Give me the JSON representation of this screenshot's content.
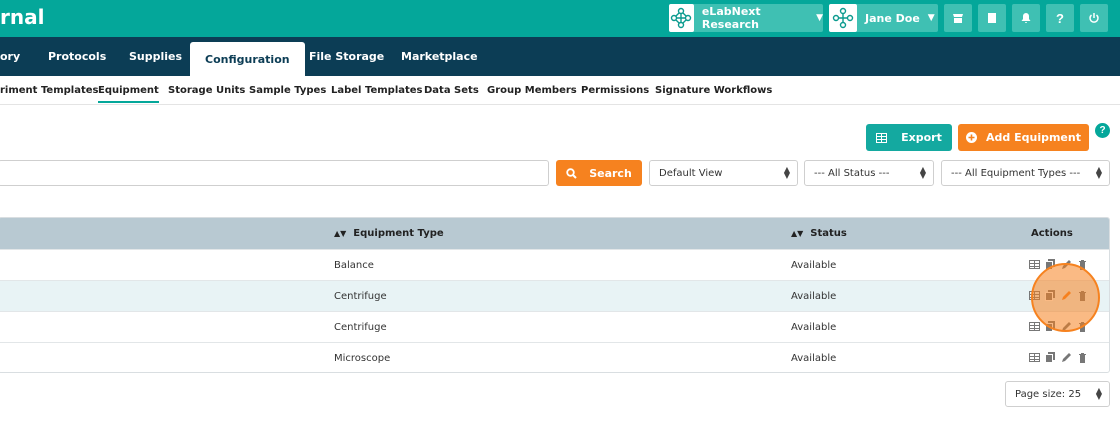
{
  "brand": {
    "text": "rnal"
  },
  "topbar": {
    "org_label": "eLabNext Research",
    "user_label": "Jane Doe",
    "icons": [
      "store-icon",
      "book-icon",
      "bell-icon",
      "help-icon",
      "power-icon"
    ],
    "help_label": "?"
  },
  "nav": {
    "tabs": [
      {
        "label": "ory"
      },
      {
        "label": "Protocols"
      },
      {
        "label": "Supplies"
      },
      {
        "label": "Configuration"
      },
      {
        "label": "File Storage"
      },
      {
        "label": "Marketplace"
      }
    ],
    "active": "Configuration"
  },
  "subnav": {
    "tabs": [
      {
        "label": "riment Templates"
      },
      {
        "label": "Equipment"
      },
      {
        "label": "Storage Units"
      },
      {
        "label": "Sample Types"
      },
      {
        "label": "Label Templates"
      },
      {
        "label": "Data Sets"
      },
      {
        "label": "Group Members"
      },
      {
        "label": "Permissions"
      },
      {
        "label": "Signature Workflows"
      }
    ],
    "active": "Equipment"
  },
  "toolbar": {
    "export_label": "Export",
    "add_label": "Add Equipment",
    "help_label": "?",
    "search_label": "Search",
    "search_value": "",
    "view_select": "Default View",
    "status_select": "--- All Status ---",
    "type_select": "--- All Equipment Types ---"
  },
  "table": {
    "columns": [
      "Equipment Type",
      "Status",
      "Actions"
    ],
    "rows": [
      {
        "type": "Balance",
        "status": "Available"
      },
      {
        "type": "Centrifuge",
        "status": "Available"
      },
      {
        "type": "Centrifuge",
        "status": "Available"
      },
      {
        "type": "Microscope",
        "status": "Available"
      }
    ]
  },
  "footer": {
    "page_size": "Page size: 25"
  },
  "colors": {
    "teal": "#04a79a",
    "navy": "#0c3d55",
    "orange": "#f6821f"
  }
}
